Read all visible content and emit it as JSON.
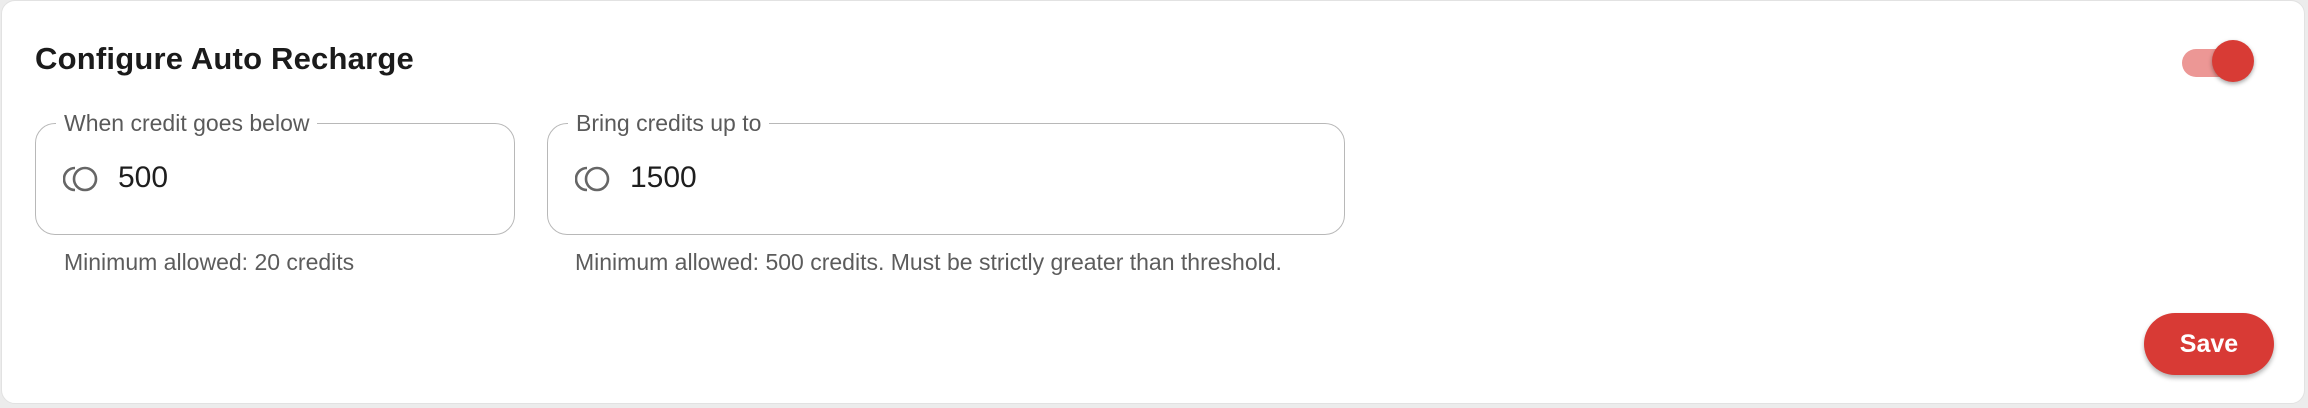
{
  "section": {
    "title": "Configure Auto Recharge",
    "auto_recharge_enabled": true
  },
  "threshold_field": {
    "label": "When credit goes below",
    "value": "500",
    "icon": "coins-icon",
    "helper": "Minimum allowed: 20 credits"
  },
  "target_field": {
    "label": "Bring credits up to",
    "value": "1500",
    "icon": "coins-icon",
    "helper": "Minimum allowed: 500 credits. Must be strictly greater than threshold."
  },
  "actions": {
    "save_label": "Save"
  },
  "colors": {
    "accent": "#d83b35",
    "toggle_track": "#ec9795",
    "border": "#b8b8b8",
    "helper_text": "#5c5c5c"
  }
}
